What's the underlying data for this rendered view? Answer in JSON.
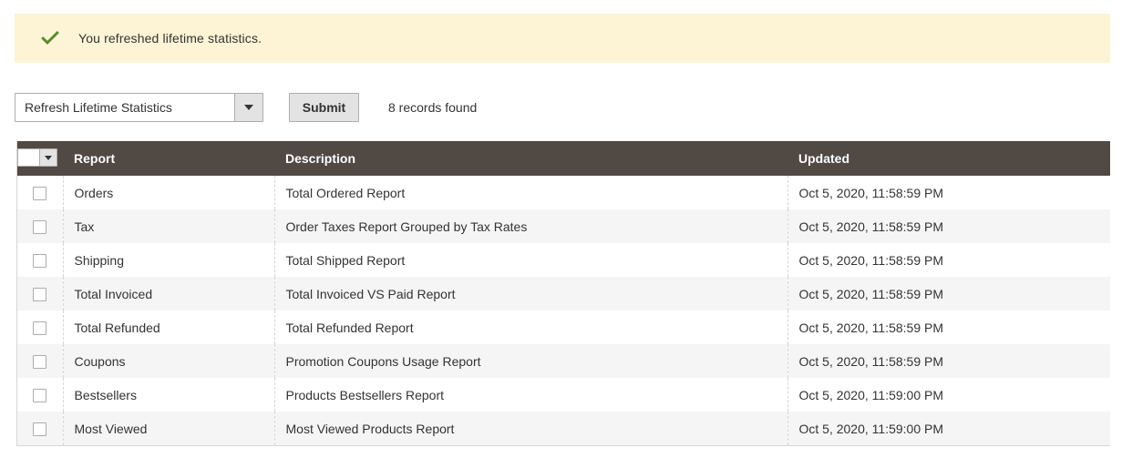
{
  "message": {
    "icon": "check-icon",
    "text": "You refreshed lifetime statistics.",
    "background": "#fcf4d4",
    "icon_color": "#5a8a2a"
  },
  "controls": {
    "action_select": {
      "value": "Refresh Lifetime Statistics",
      "arrow_icon": "chevron-down-icon"
    },
    "submit_label": "Submit",
    "records_found": "8 records found"
  },
  "grid": {
    "header_background": "#514943",
    "mass_select": {
      "checkbox": "",
      "arrow_icon": "chevron-down-icon"
    },
    "columns": [
      {
        "key": "check",
        "label": ""
      },
      {
        "key": "report",
        "label": "Report"
      },
      {
        "key": "description",
        "label": "Description"
      },
      {
        "key": "updated",
        "label": "Updated"
      }
    ],
    "rows": [
      {
        "report": "Orders",
        "description": "Total Ordered Report",
        "updated": "Oct 5, 2020, 11:58:59 PM"
      },
      {
        "report": "Tax",
        "description": "Order Taxes Report Grouped by Tax Rates",
        "updated": "Oct 5, 2020, 11:58:59 PM"
      },
      {
        "report": "Shipping",
        "description": "Total Shipped Report",
        "updated": "Oct 5, 2020, 11:58:59 PM"
      },
      {
        "report": "Total Invoiced",
        "description": "Total Invoiced VS Paid Report",
        "updated": "Oct 5, 2020, 11:58:59 PM"
      },
      {
        "report": "Total Refunded",
        "description": "Total Refunded Report",
        "updated": "Oct 5, 2020, 11:58:59 PM"
      },
      {
        "report": "Coupons",
        "description": "Promotion Coupons Usage Report",
        "updated": "Oct 5, 2020, 11:58:59 PM"
      },
      {
        "report": "Bestsellers",
        "description": "Products Bestsellers Report",
        "updated": "Oct 5, 2020, 11:59:00 PM"
      },
      {
        "report": "Most Viewed",
        "description": "Most Viewed Products Report",
        "updated": "Oct 5, 2020, 11:59:00 PM"
      }
    ]
  }
}
